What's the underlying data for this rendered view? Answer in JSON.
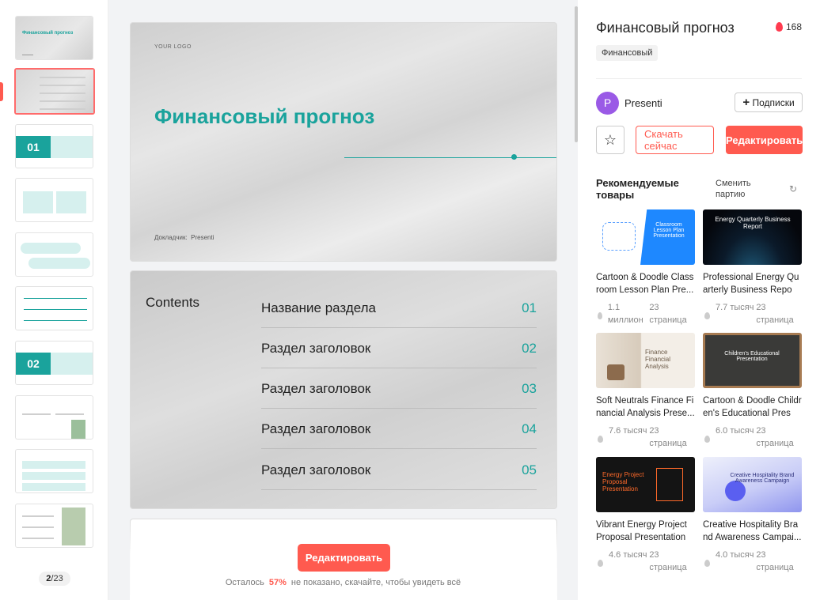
{
  "rail": {
    "page_current": "2",
    "page_total": "/23",
    "thumbs": [
      {
        "kind": "title",
        "label": "Финансовый прогноз"
      },
      {
        "kind": "contents"
      },
      {
        "kind": "section",
        "num": "01"
      },
      {
        "kind": "content"
      },
      {
        "kind": "content"
      },
      {
        "kind": "content"
      },
      {
        "kind": "section",
        "num": "02"
      },
      {
        "kind": "content"
      },
      {
        "kind": "content"
      },
      {
        "kind": "content"
      }
    ]
  },
  "slide1": {
    "logo": "YOUR LOGO",
    "title": "Финансовый прогноз",
    "speaker_label": "Докладчик:",
    "speaker_name": "Presenti"
  },
  "slide2": {
    "title": "Contents",
    "rows": [
      {
        "text": "Название раздела",
        "num": "01"
      },
      {
        "text": "Раздел заголовок",
        "num": "02"
      },
      {
        "text": "Раздел заголовок",
        "num": "03"
      },
      {
        "text": "Раздел заголовок",
        "num": "04"
      },
      {
        "text": "Раздел заголовок",
        "num": "05"
      }
    ]
  },
  "center": {
    "edit_label": "Редактировать",
    "remain_prefix": "Осталось",
    "remain_pct": "57%",
    "remain_suffix": "не показано, скачайте, чтобы увидеть всё"
  },
  "panel": {
    "title": "Финансовый прогноз",
    "likes": "168",
    "tag": "Финансовый",
    "author_initial": "P",
    "author": "Presenti",
    "subscribe": "Подписки",
    "subscribe_icon": "+",
    "star_icon": "☆",
    "download": "Скачать сейчас",
    "edit": "Редактировать",
    "rec_title": "Рекомендуемые товары",
    "rec_switch": "Сменить партию",
    "refresh_icon": "↻"
  },
  "cards": [
    {
      "name": "Cartoon & Doodle Classroom Lesson Plan Pre...",
      "views": "1.1 миллион",
      "pages": "23 страница",
      "img_text": "Classroom Lesson Plan Presentation",
      "theme": "blue"
    },
    {
      "name": "Professional Energy Quarterly Business Repor...",
      "views": "7.7 тысяч",
      "pages": "23 страница",
      "img_text": "Energy Quarterly Business Report",
      "theme": "dark"
    },
    {
      "name": "Soft Neutrals Finance Financial Analysis Prese...",
      "views": "7.6 тысяч",
      "pages": "23 страница",
      "img_text": "Finance Financial Analysis",
      "theme": "beige"
    },
    {
      "name": "Cartoon & Doodle Children's Educational Prese...",
      "views": "6.0 тысяч",
      "pages": "23 страница",
      "img_text": "Children's Educational Presentation",
      "theme": "chalk"
    },
    {
      "name": "Vibrant Energy Project Proposal Presentation ...",
      "views": "4.6 тысяч",
      "pages": "23 страница",
      "img_text": "Energy Project Proposal Presentation",
      "theme": "orange"
    },
    {
      "name": "Creative Hospitality Brand Awareness Campai...",
      "views": "4.0 тысяч",
      "pages": "23 страница",
      "img_text": "Creative Hospitality Brand Awareness Campaign",
      "theme": "purple"
    }
  ],
  "colors": {
    "accent": "#ff5a4f",
    "teal": "#1aa39c",
    "avatar": "#9a5ae6"
  }
}
